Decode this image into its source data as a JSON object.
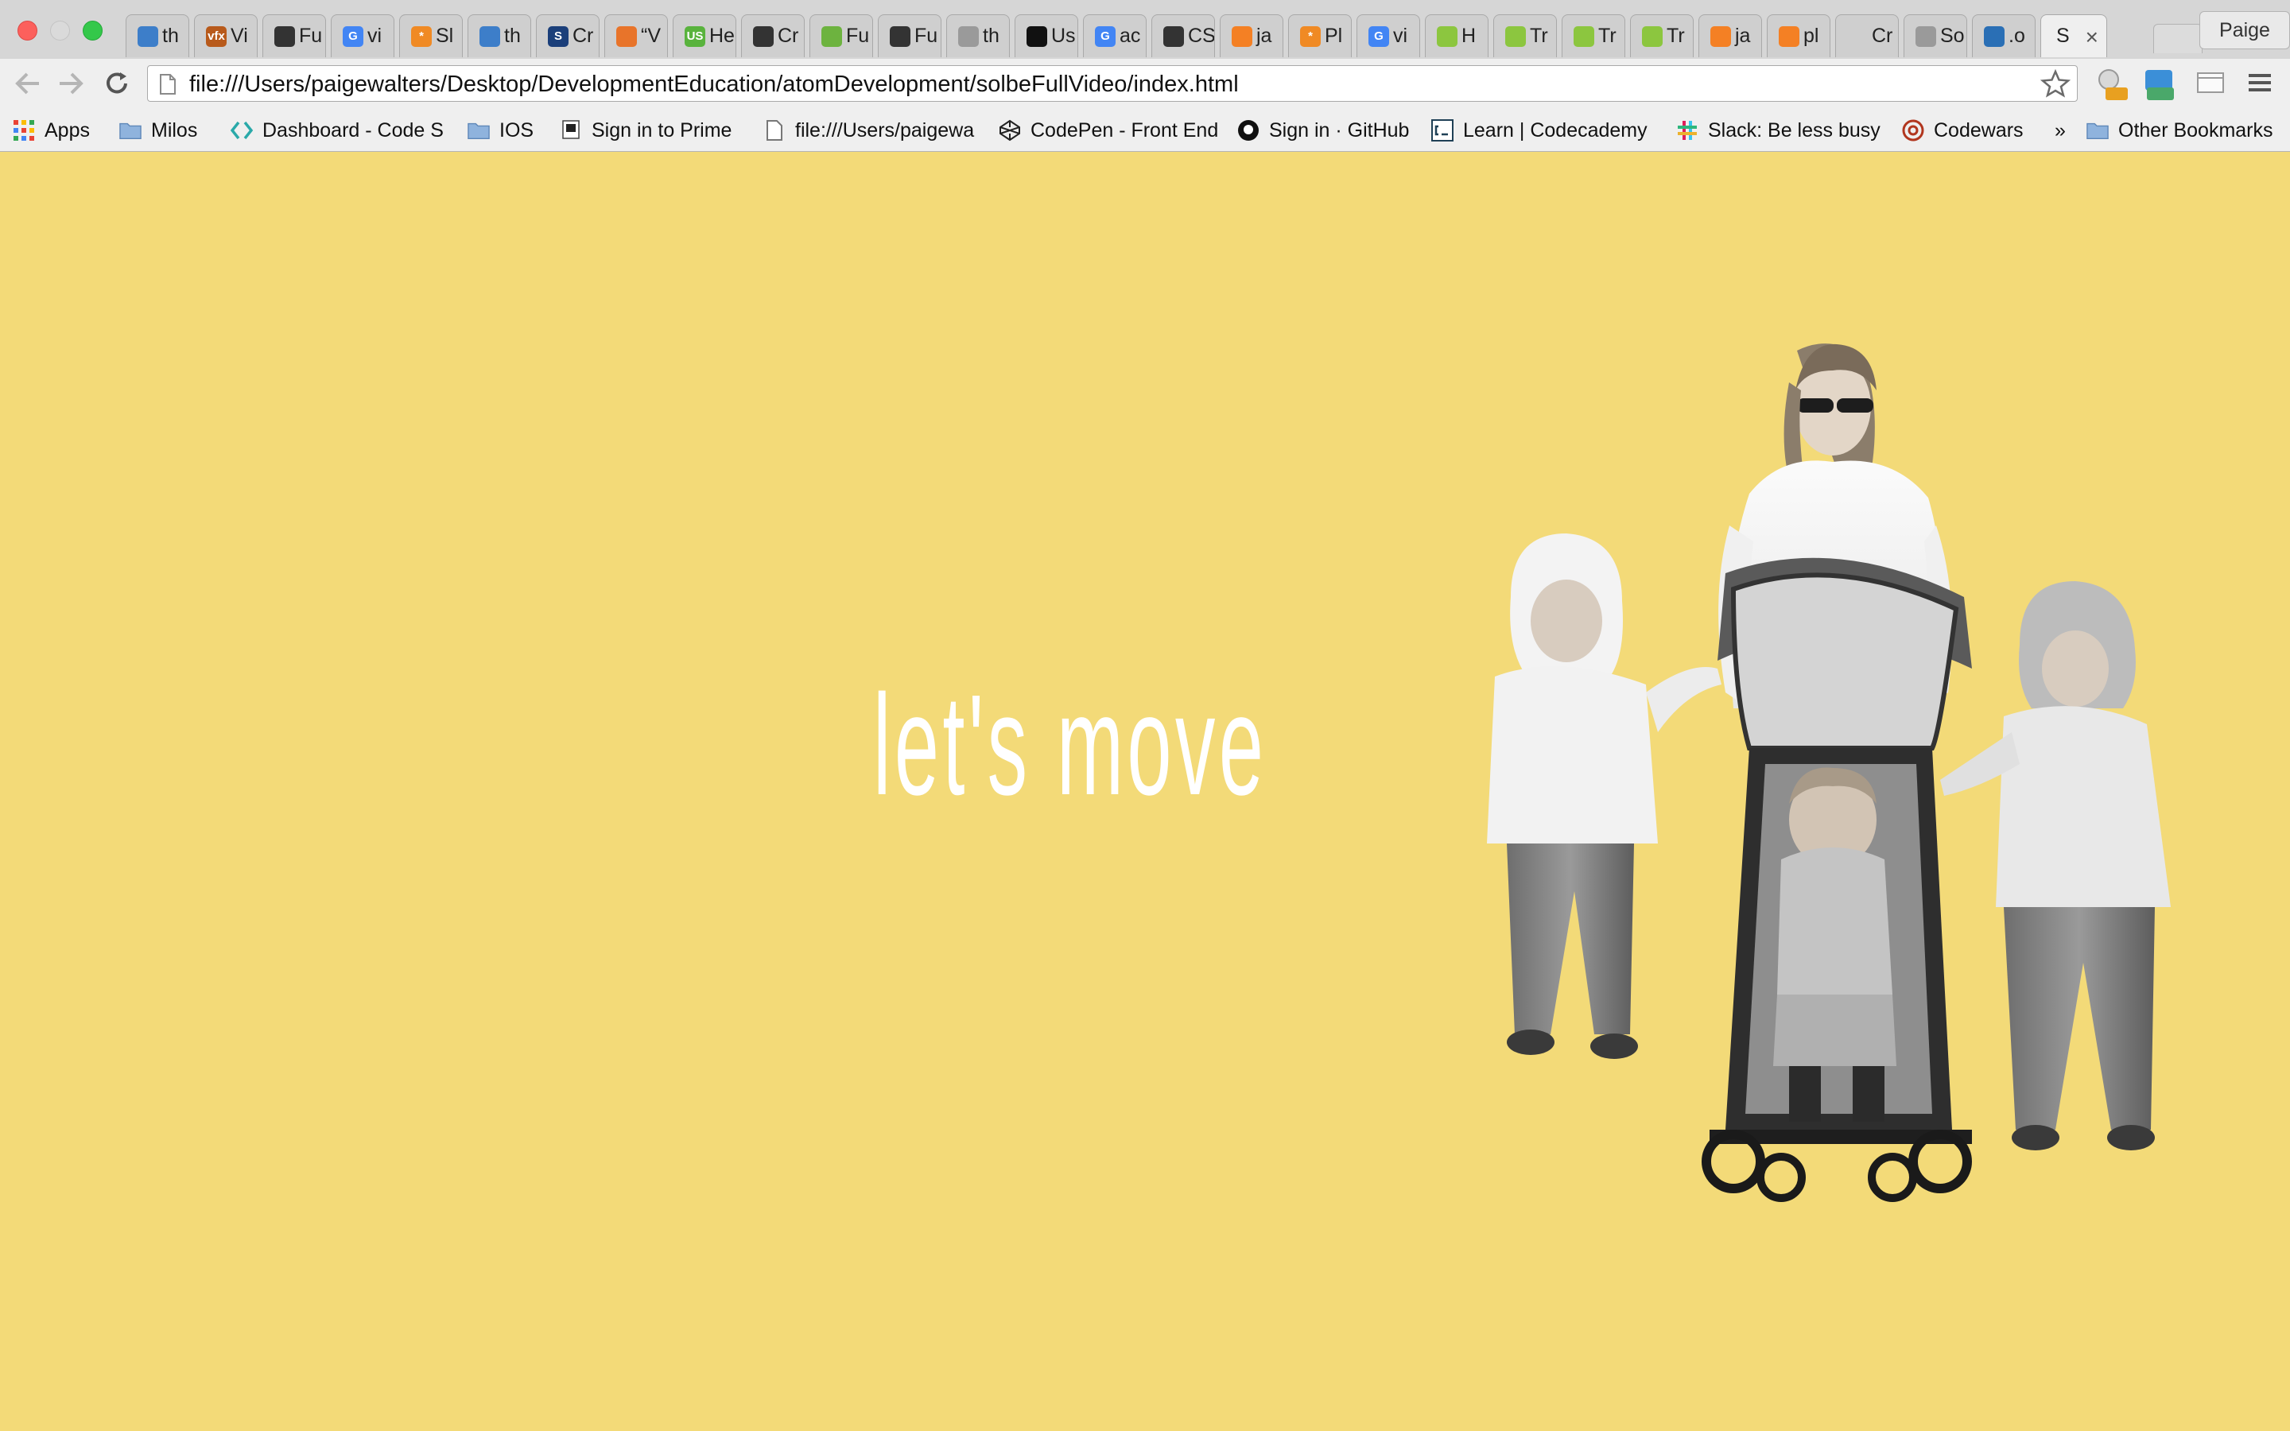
{
  "window": {
    "profile_name": "Paige"
  },
  "tabs": [
    {
      "fav_color": "#3d7ec9",
      "fav_text": "",
      "label": "th"
    },
    {
      "fav_color": "#b85a1b",
      "fav_text": "vfx",
      "label": "Vi"
    },
    {
      "fav_color": "#333333",
      "fav_text": "",
      "label": "Fu"
    },
    {
      "fav_color": "#4285f4",
      "fav_text": "G",
      "label": "vi"
    },
    {
      "fav_color": "#f08a24",
      "fav_text": "*",
      "label": "Sl"
    },
    {
      "fav_color": "#3d7ec9",
      "fav_text": "",
      "label": "th"
    },
    {
      "fav_color": "#1b3f7a",
      "fav_text": "S",
      "label": "Cr"
    },
    {
      "fav_color": "#e8742a",
      "fav_text": "",
      "label": "“V"
    },
    {
      "fav_color": "#59b33d",
      "fav_text": "US",
      "label": "He"
    },
    {
      "fav_color": "#333333",
      "fav_text": "",
      "label": "Cr"
    },
    {
      "fav_color": "#6db33f",
      "fav_text": "",
      "label": "Fu"
    },
    {
      "fav_color": "#333333",
      "fav_text": "",
      "label": "Fu"
    },
    {
      "fav_color": "#9a9a9a",
      "fav_text": "",
      "label": "th"
    },
    {
      "fav_color": "#111111",
      "fav_text": "",
      "label": "Us"
    },
    {
      "fav_color": "#4285f4",
      "fav_text": "G",
      "label": "ac"
    },
    {
      "fav_color": "#333333",
      "fav_text": "",
      "label": "CS"
    },
    {
      "fav_color": "#f48024",
      "fav_text": "",
      "label": "ja"
    },
    {
      "fav_color": "#f08a24",
      "fav_text": "*",
      "label": "Pl"
    },
    {
      "fav_color": "#4285f4",
      "fav_text": "G",
      "label": "vi"
    },
    {
      "fav_color": "#8cc63f",
      "fav_text": "",
      "label": "H"
    },
    {
      "fav_color": "#8cc63f",
      "fav_text": "",
      "label": "Tr"
    },
    {
      "fav_color": "#8cc63f",
      "fav_text": "",
      "label": "Tr"
    },
    {
      "fav_color": "#8cc63f",
      "fav_text": "",
      "label": "Tr"
    },
    {
      "fav_color": "#f48024",
      "fav_text": "",
      "label": "ja"
    },
    {
      "fav_color": "#f48024",
      "fav_text": "",
      "label": "pl"
    },
    {
      "fav_color": "#cfcfcf",
      "fav_text": "",
      "label": "Cr"
    },
    {
      "fav_color": "#9a9a9a",
      "fav_text": "",
      "label": "So"
    },
    {
      "fav_color": "#2a6fb5",
      "fav_text": "",
      "label": ".o"
    },
    {
      "fav_color": "",
      "fav_text": "",
      "label": "S",
      "active": true
    }
  ],
  "omnibox": {
    "url": "file:///Users/paigewalters/Desktop/DevelopmentEducation/atomDevelopment/solbeFullVideo/index.html"
  },
  "bookmarks": {
    "apps": "Apps",
    "items": [
      {
        "label": "Milos",
        "icon": "folder-icon"
      },
      {
        "label": "Dashboard - Code S",
        "icon": "code-icon"
      },
      {
        "label": "IOS",
        "icon": "folder-icon"
      },
      {
        "label": "Sign in to Prime",
        "icon": "prime-icon"
      },
      {
        "label": "file:///Users/paigewa",
        "icon": "page-icon"
      },
      {
        "label": "CodePen - Front End",
        "icon": "codepen-icon"
      },
      {
        "label": "Sign in · GitHub",
        "icon": "github-icon"
      },
      {
        "label": "Learn | Codecademy",
        "icon": "codecademy-icon"
      },
      {
        "label": "Slack: Be less busy",
        "icon": "slack-icon"
      },
      {
        "label": "Codewars",
        "icon": "codewars-icon"
      }
    ],
    "overflow": "»",
    "other": "Other Bookmarks"
  },
  "page": {
    "headline": "let's move"
  },
  "colors": {
    "background": "#f3da78",
    "headline": "#ffffff"
  }
}
